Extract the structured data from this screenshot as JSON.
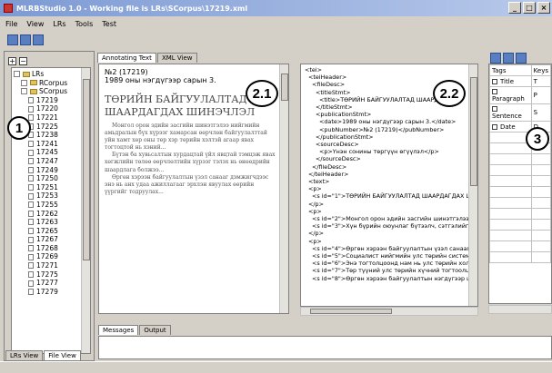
{
  "window": {
    "title": "MLRBStudio 1.0 - Working file is LRs\\SCorpus\\17219.xml"
  },
  "menu": [
    "File",
    "View",
    "LRs",
    "Tools",
    "Test"
  ],
  "tree": {
    "root": "LRs",
    "children": [
      "RCorpus",
      "SCorpus"
    ],
    "files": [
      "17219",
      "17220",
      "17221",
      "17225",
      "17238",
      "17241",
      "17245",
      "17247",
      "17249",
      "17250",
      "17251",
      "17253",
      "17255",
      "17262",
      "17263",
      "17265",
      "17267",
      "17268",
      "17269",
      "17271",
      "17275",
      "17277",
      "17279"
    ]
  },
  "bottom_left_tabs": [
    "LRs View",
    "File View"
  ],
  "center_tabs": [
    "Annotating Text",
    "XML View"
  ],
  "annotating": {
    "header1": "№2 (17219)",
    "header2": "1989 оны нэгдүгээр сарын 3.",
    "title": "ТӨРИЙН БАЙГУУЛАЛТАД ШААРДАГДАХ ШИНЭЧЛЭЛ",
    "paragraphs": [
      "Монгол орон эдийн засгийн шинэтгэлээ нийгмийн амьдралын бүх хүрээг хамарсан өөрчлөн байгуулалттай уйн хамт хөр оны төр хэр төрийн хэлтэй агаар явах тогтоцтой нь хэний...",
      "Бүтэн ба хувьсалтын хурдацтай үйл явцтай тэмцэж явах хөгжлийн төлөө өөрчлөлтийн хүрээг тэлэх нь өнөөдрийн шаардлага болжээ...",
      "Өргөн хэрээн байгуулалтын үзэл санааг дэмжигчдээс энэ нь анх удаа ажиллагааг эрхлэн явуулах өөрийн үүргийг тодруулах..."
    ]
  },
  "xml_lines": [
    "<tei>",
    "<teiHeader>",
    "<fileDesc>",
    "<titleStmt>",
    "<title>ТӨРИЙН БАЙГУУЛАЛТАД ШААРДАГДАХ",
    "</titleStmt>",
    "<publicationStmt>",
    "<date>1989 оны нэгдүгээр сарын 3.</date>",
    "<pubNumber>№2 (17219)</pubNumber>",
    "</publicationStmt>",
    "<sourceDesc>",
    "<p>Үнэн сонины төргүүн өгүүлэл</p>",
    "</sourceDesc>",
    "</fileDesc>",
    "</teiHeader>",
    "<text>",
    "<p>",
    "<s id=\"1\">ТӨРИЙН БАЙГУУЛАЛТАД ШААРДАГДАХ ШИНЭ",
    "</p>",
    "<p>",
    "<s id=\"2\">Монгол орон эдийн засгийн шинэтгэлээ нийгм",
    "<s id=\"3\">Хүн бүрийн оюунлаг бүтээлч, сэтгэлийг доргоду",
    "</p>",
    "<p>",
    "<s id=\"4\">Өргөн хэрээн байгуулалтын үзэл санааг дэмжи",
    "<s id=\"5\">Социалист нийгмийн улс төрийн системд шинэч",
    "<s id=\"6\">Энэ тогтолцоонд нам нь улс төрийн холоодогч",
    "<s id=\"7\">Төр түүний улс төрийн хүчний тогтоолцоо их",
    "<s id=\"8\">Өргөн хэрээн байгуулалтын нэгдүгээр шатанд"
  ],
  "tags_table": {
    "headers": [
      "Tags",
      "Keys"
    ],
    "rows": [
      [
        "Title",
        "T"
      ],
      [
        "Paragraph",
        "P"
      ],
      [
        "Sentence",
        "S"
      ],
      [
        "Date",
        "D"
      ]
    ]
  },
  "bottom_tabs": [
    "Messages",
    "Output"
  ],
  "callouts": [
    "1",
    "2.1",
    "2.2",
    "3"
  ]
}
